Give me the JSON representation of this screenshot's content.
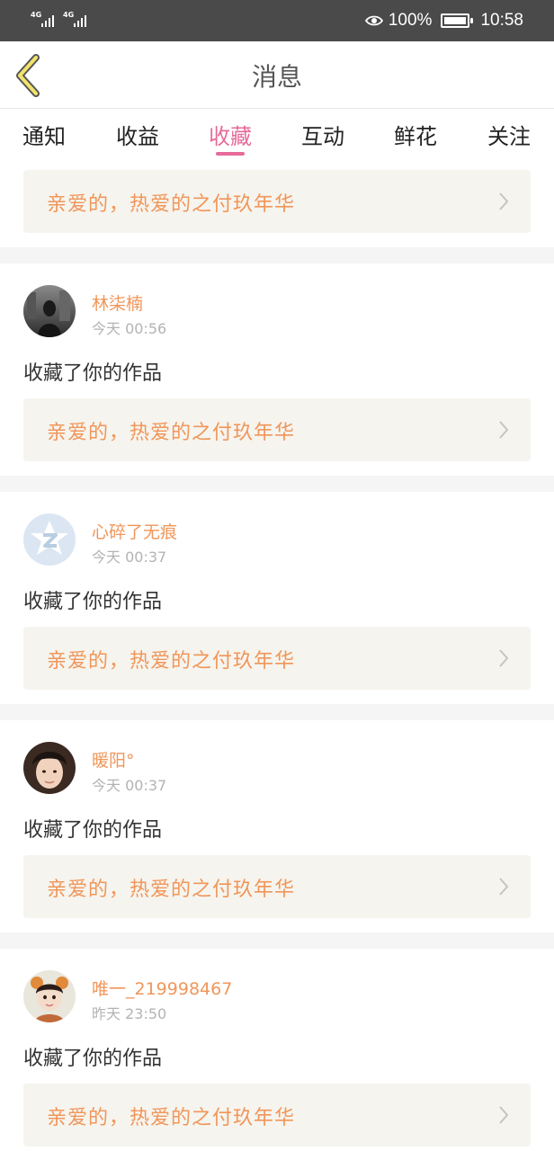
{
  "status_bar": {
    "signal_1": "4G",
    "signal_2": "4G",
    "battery": "100%",
    "time": "10:58",
    "icons": [
      "signal-icon",
      "eye-icon",
      "battery-icon"
    ]
  },
  "header": {
    "title": "消息",
    "back_icon": "chevron-left-icon"
  },
  "tabs": [
    {
      "label": "通知"
    },
    {
      "label": "收益"
    },
    {
      "label": "收藏",
      "active": true
    },
    {
      "label": "互动"
    },
    {
      "label": "鲜花"
    },
    {
      "label": "关注"
    }
  ],
  "top_card": {
    "title": "亲爱的，热爱的之付玖年华"
  },
  "items": [
    {
      "user": "林柒楠",
      "time": "今天 00:56",
      "action": "收藏了你的作品",
      "work_title": "亲爱的，热爱的之付玖年华"
    },
    {
      "user": "心碎了无痕",
      "time": "今天 00:37",
      "action": "收藏了你的作品",
      "work_title": "亲爱的，热爱的之付玖年华"
    },
    {
      "user": "暖阳°",
      "time": "今天 00:37",
      "action": "收藏了你的作品",
      "work_title": "亲爱的，热爱的之付玖年华"
    },
    {
      "user": "唯一_219998467",
      "time": "昨天 23:50",
      "action": "收藏了你的作品",
      "work_title": "亲爱的，热爱的之付玖年华"
    }
  ],
  "colors": {
    "accent_pink": "#e66b9a",
    "name_orange": "#f0965a",
    "card_bg": "#f6f4ee",
    "status_bar_bg": "#4a4a4a"
  }
}
